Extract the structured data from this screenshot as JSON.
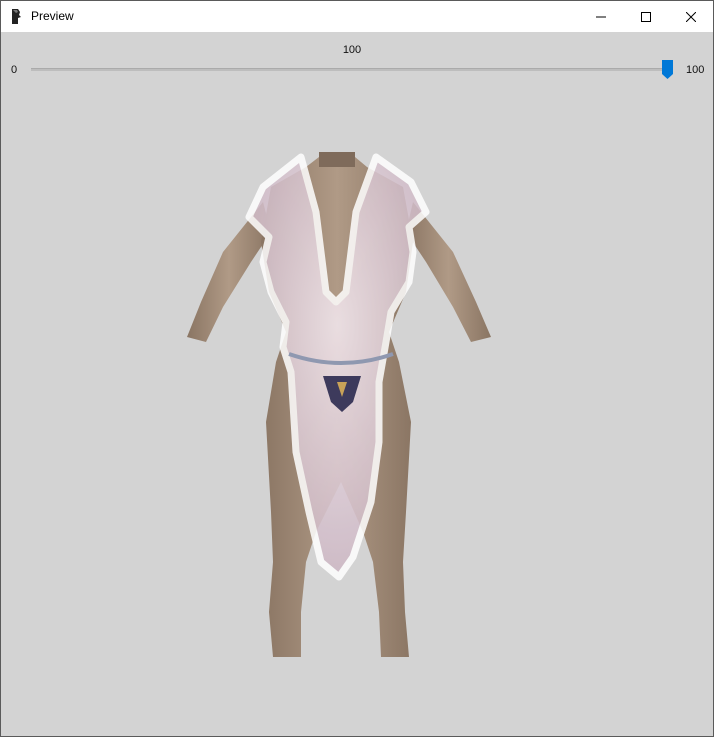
{
  "window": {
    "title": "Preview",
    "icon": "app-icon",
    "controls": {
      "minimize": "minimize-icon",
      "maximize": "maximize-icon",
      "close": "close-icon"
    }
  },
  "slider": {
    "value": "100",
    "min_label": "0",
    "max_label": "100",
    "level": 1.0,
    "accent": "#0078d7"
  },
  "viewport": {
    "background": "#d3d3d3",
    "content": "3D body mesh preview wearing sheer white outfit"
  }
}
